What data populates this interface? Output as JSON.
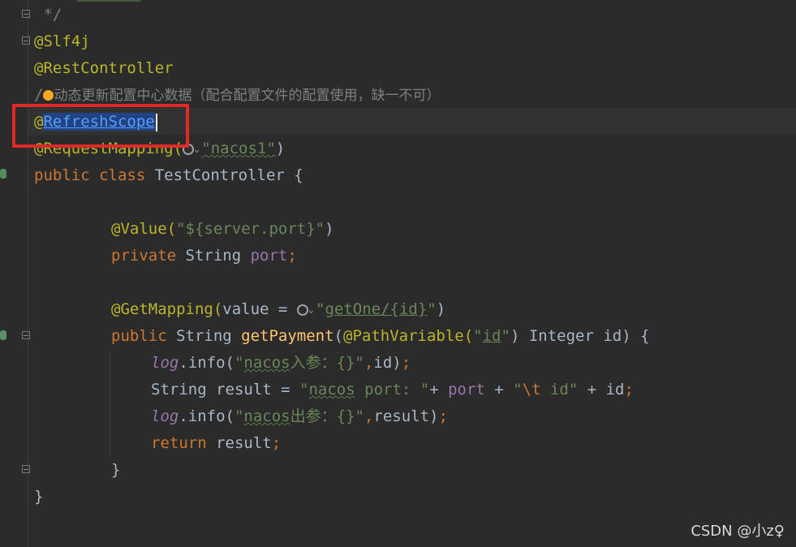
{
  "editor": {
    "lines": {
      "l0": " */",
      "l1": "@Slf4j",
      "l2": "@RestController",
      "l3_slash": "/",
      "l3_comment": "动态更新配置中心数据（配合配置文件的配置使用，缺一不可）",
      "l4_at": "@",
      "l4_name": "RefreshScope",
      "l5_ann": "@RequestMapping(",
      "l5_str": "\"nacos1\"",
      "l5_close": ")",
      "l6_kw": "public class ",
      "l6_rest": "TestController {",
      "l8_ann": "@Value(",
      "l8_str": "\"${server.port}\"",
      "l8_close": ")",
      "l9_kw": "private ",
      "l9_type": "String ",
      "l9_fld": "port",
      "l9_semi": ";",
      "l11_ann": "@GetMapping(",
      "l11_val": "value = ",
      "l11_q1": "\"",
      "l11_url": "getOne/{id}",
      "l11_q2": "\"",
      "l11_close": ")",
      "l12_kw": "public ",
      "l12_type": "String ",
      "l12_fn": "getPayment",
      "l12_p": "(",
      "l12_ann": "@PathVariable(",
      "l12_q1": "\"",
      "l12_id": "id",
      "l12_q2": "\"",
      "l12_rest": ") Integer id) {",
      "l13_log": "log",
      "l13_call": ".info(",
      "l13_q": "\"",
      "l13_nacos": "nacos",
      "l13_str": "入参：{}\"",
      "l13_comma": ",",
      "l13_end": "id)",
      "l13_semi": ";",
      "l14_a": "String result = ",
      "l14_q": "\"",
      "l14_nacos": "nacos",
      "l14_s": " port: \"",
      "l14_plus": "+ ",
      "l14_port": "port",
      "l14_b": " + ",
      "l14_s2q": "\"",
      "l14_esc": "\\t",
      "l14_s2": " id\"",
      "l14_c": " + id",
      "l14_semi": ";",
      "l15_log": "log",
      "l15_call": ".info(",
      "l15_q": "\"",
      "l15_nacos": "nacos",
      "l15_str": "出参：{}\"",
      "l15_comma": ",",
      "l15_end": "result)",
      "l15_semi": ";",
      "l16_kw": "return ",
      "l16_rest": "result",
      "l16_semi": ";",
      "l17": "}",
      "l18": "}"
    },
    "icons": [
      "globe-icon",
      "chevron-down-icon",
      "intention-bulb-icon",
      "fold-icon",
      "spring-bean-gutter-icon"
    ]
  },
  "watermark": "CSDN @小z♀",
  "colors": {
    "background": "#2b2b2b",
    "annotation": "#bbb529",
    "keyword": "#cc7832",
    "string": "#6a8759",
    "field": "#9876aa",
    "method": "#ffc66d",
    "comment": "#808080",
    "highlight_box": "#e02a2a"
  }
}
